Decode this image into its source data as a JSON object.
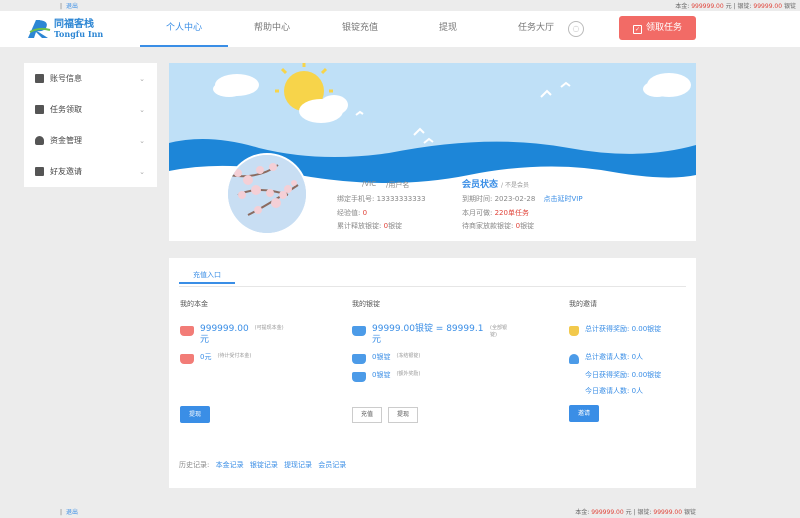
{
  "topbar": {
    "logout": "退出",
    "balance_label": "本金:",
    "balance_value": "999999.00",
    "balance_unit": "元",
    "silver_label": "银锭:",
    "silver_value": "99999.00",
    "silver_unit": "银锭"
  },
  "header": {
    "logo_cn": "同福客栈",
    "logo_en": "Tongfu Inn",
    "nav": [
      {
        "label": "个人中心"
      },
      {
        "label": "帮助中心"
      },
      {
        "label": "银锭充值"
      },
      {
        "label": "提现"
      },
      {
        "label": "任务大厅"
      }
    ],
    "bell": "◌",
    "task_button": "领取任务"
  },
  "sidebar": {
    "items": [
      {
        "label": "账号信息",
        "icon": "user-icon"
      },
      {
        "label": "任务领取",
        "icon": "list-icon"
      },
      {
        "label": "资金管理",
        "icon": "money-bag-icon"
      },
      {
        "label": "好友邀请",
        "icon": "mail-icon"
      }
    ]
  },
  "profile": {
    "level_a": "/VIC",
    "level_b": "/用户名",
    "phone_label": "绑定手机号:",
    "phone": "13333333333",
    "exp_label": "经验值:",
    "exp": "0",
    "released_label": "累计释放银锭:",
    "released": "0",
    "released_unit": "银锭",
    "member_title": "会员状态",
    "member_sub": "/ 不是会员",
    "expire_label": "到期时间:",
    "expire": "2023-02-28",
    "vip_link": "点击延时VIP",
    "monthly_label": "本月可做:",
    "monthly": "220单任务",
    "wait_label": "待商家放款银锭:",
    "wait": "0",
    "wait_unit": "银锭"
  },
  "money": {
    "tab": "充值入口",
    "capital": {
      "title": "我的本金",
      "amount": "999999.00",
      "amount_unit": "元",
      "amount_note": "(可提现本金)",
      "frozen": "0元",
      "frozen_note": "(待计受付本金)",
      "button": "提现"
    },
    "silver": {
      "title": "我的银锭",
      "amount": "99999.00银锭 = 89999.1",
      "amount_unit": "元",
      "amount_note": "(全部银锭)",
      "pending": "0银锭",
      "pending_note": "(冻结银锭)",
      "reward": "0银锭",
      "reward_note": "(额外奖励)",
      "recharge_button": "充值",
      "withdraw_button": "提现"
    },
    "invite": {
      "title": "我的邀请",
      "total_reward": "总计获得奖励: 0.00银锭",
      "total_people": "总计邀请人数: 0人",
      "today_reward": "今日获得奖励: 0.00银锭",
      "today_people": "今日邀请人数: 0人",
      "button": "邀请"
    },
    "history_label": "历史记录:",
    "history": [
      "本金记录",
      "银锭记录",
      "提现记录",
      "会员记录"
    ]
  },
  "footer": {
    "logout": "退出",
    "balance_label": "本金:",
    "balance_value": "999999.00",
    "balance_unit": "元",
    "silver_label": "银锭:",
    "silver_value": "99999.00",
    "silver_unit": "银锭"
  },
  "colors": {
    "accent": "#3a8ee6",
    "danger": "#f26b66",
    "sky": "#bfe0f7",
    "wave": "#1d86d8"
  }
}
